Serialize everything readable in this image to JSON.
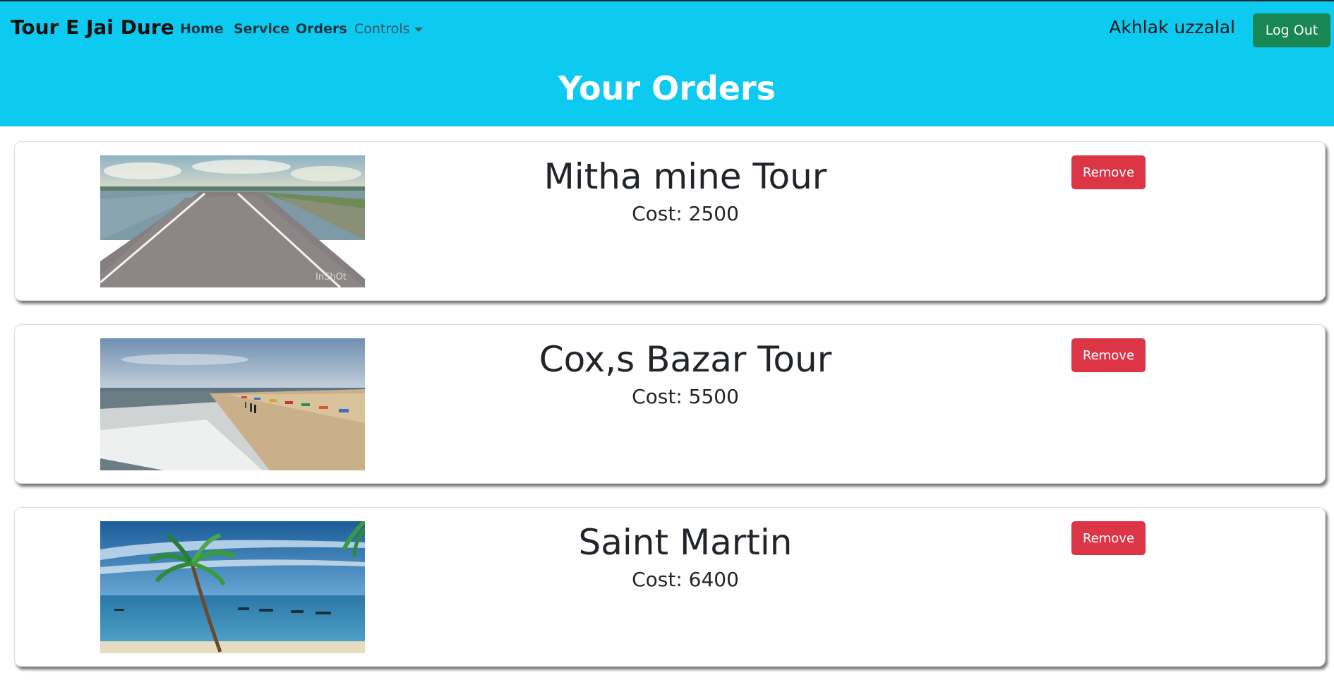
{
  "navbar": {
    "brand": "Tour E Jai Dure",
    "links": {
      "home": "Home",
      "service": "Service",
      "orders": "Orders",
      "controls": "Controls"
    },
    "user_name": "Akhlak uzzalal",
    "logout_label": "Log Out"
  },
  "page": {
    "title": "Your Orders"
  },
  "orders": [
    {
      "title": "Mitha mine Tour",
      "cost": "Cost: 2500",
      "remove_label": "Remove",
      "image": "road-lake-photo",
      "watermark": "InShOt"
    },
    {
      "title": "Cox,s Bazar Tour",
      "cost": "Cost: 5500",
      "remove_label": "Remove",
      "image": "beach-photo"
    },
    {
      "title": "Saint Martin",
      "cost": "Cost: 6400",
      "remove_label": "Remove",
      "image": "palm-island-photo"
    }
  ],
  "colors": {
    "header": "#0dcaf0",
    "logout": "#198754",
    "remove": "#dc3545"
  }
}
